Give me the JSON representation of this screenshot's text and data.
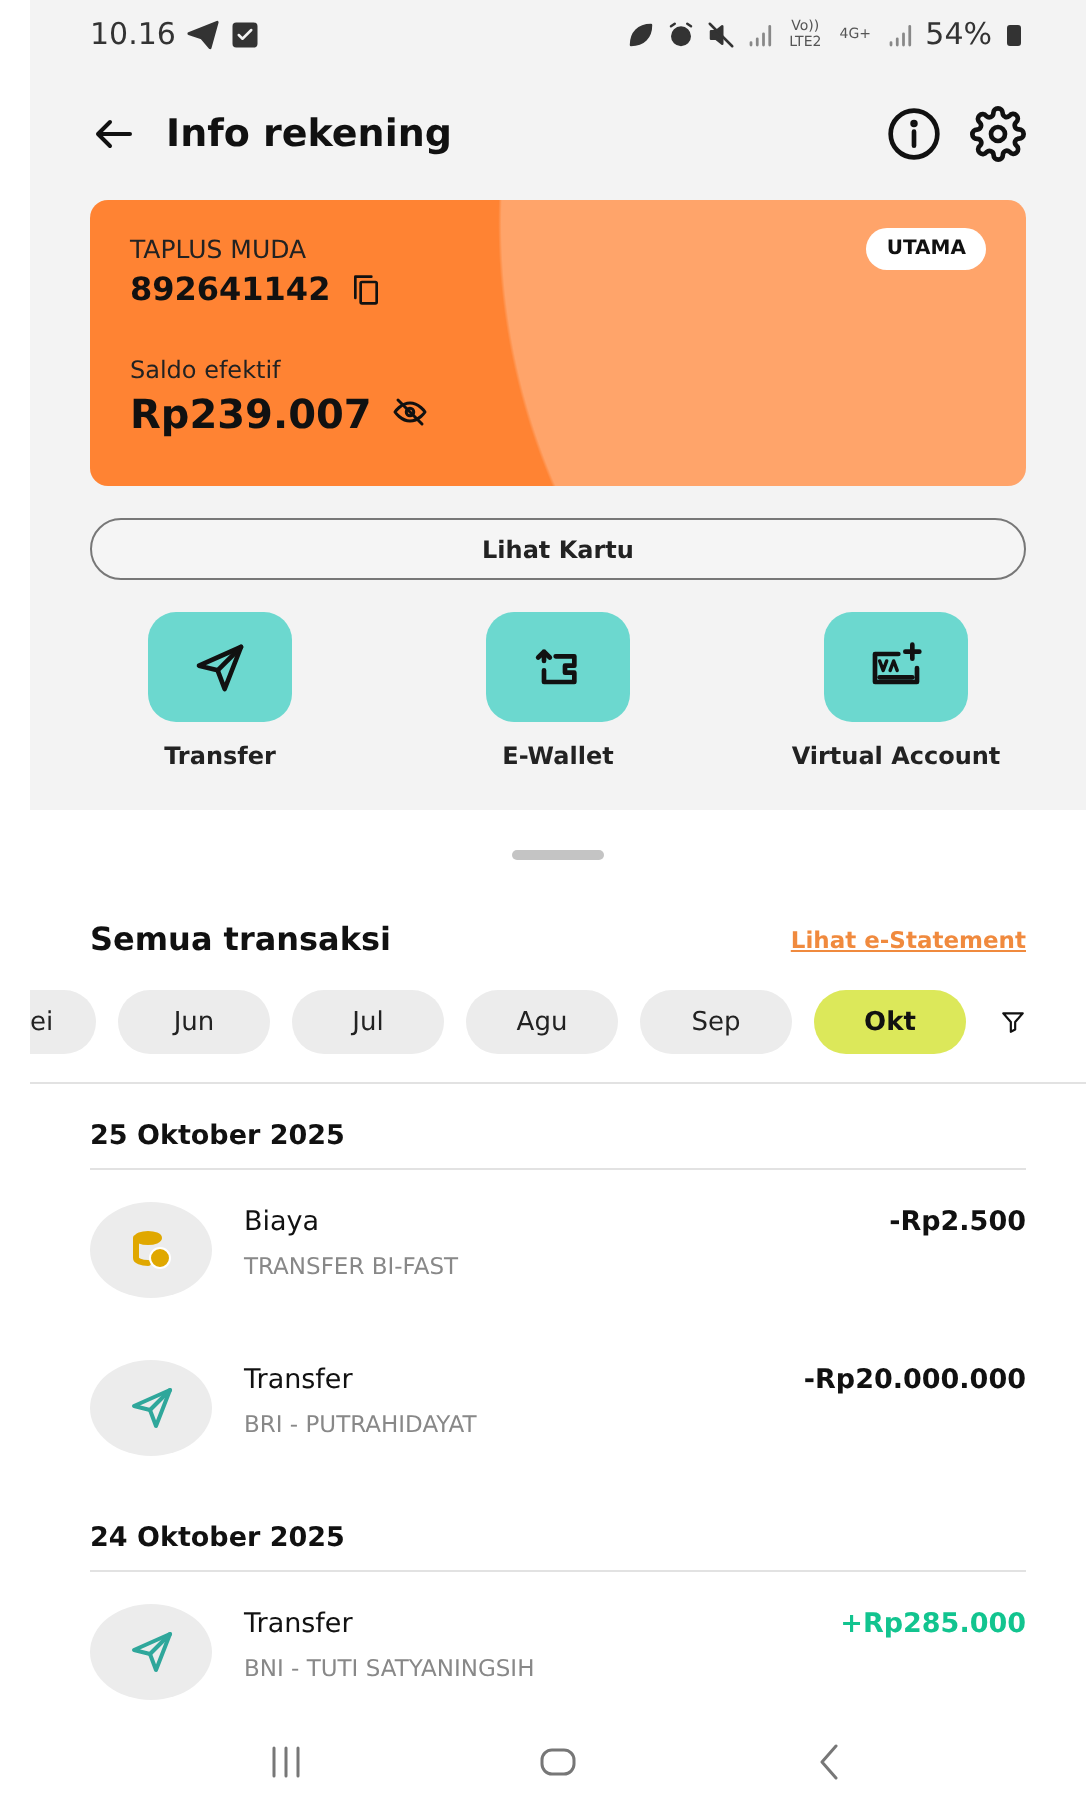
{
  "status_bar": {
    "time": "10.16",
    "network_label": "Vo)) LTE2",
    "network_type": "4G+",
    "battery": "54%"
  },
  "header": {
    "title": "Info rekening"
  },
  "account_card": {
    "product": "TAPLUS MUDA",
    "number": "892641142",
    "badge": "UTAMA",
    "balance_label": "Saldo efektif",
    "balance": "Rp239.007"
  },
  "card_button": "Lihat Kartu",
  "actions": [
    {
      "kind": "transfer",
      "label": "Transfer"
    },
    {
      "kind": "ewallet",
      "label": "E-Wallet"
    },
    {
      "kind": "va",
      "label": "Virtual Account"
    }
  ],
  "transactions": {
    "title": "Semua transaksi",
    "statement_link": "Lihat e-Statement",
    "months": [
      {
        "label": "ei",
        "selected": false
      },
      {
        "label": "Jun",
        "selected": false
      },
      {
        "label": "Jul",
        "selected": false
      },
      {
        "label": "Agu",
        "selected": false
      },
      {
        "label": "Sep",
        "selected": false
      },
      {
        "label": "Okt",
        "selected": true
      }
    ],
    "groups": [
      {
        "date": "25 Oktober 2025",
        "items": [
          {
            "kind": "fee",
            "title": "Biaya",
            "detail": "TRANSFER BI-FAST",
            "amount": "-Rp2.500",
            "incoming": false
          },
          {
            "kind": "transfer",
            "title": "Transfer",
            "detail": "BRI - PUTRAHIDAYAT",
            "amount": "-Rp20.000.000",
            "incoming": false
          }
        ]
      },
      {
        "date": "24 Oktober 2025",
        "items": [
          {
            "kind": "transfer",
            "title": "Transfer",
            "detail": "BNI - TUTI SATYANINGSIH",
            "amount": "+Rp285.000",
            "incoming": true
          }
        ]
      }
    ]
  }
}
